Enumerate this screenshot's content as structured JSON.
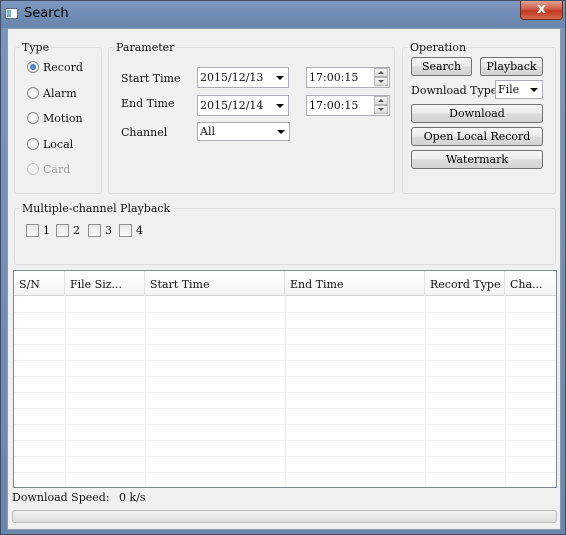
{
  "window": {
    "title": "Search",
    "close_glyph": "x"
  },
  "type_group": {
    "label": "Type",
    "options": [
      {
        "label": "Record",
        "checked": true,
        "enabled": true
      },
      {
        "label": "Alarm",
        "checked": false,
        "enabled": true
      },
      {
        "label": "Motion",
        "checked": false,
        "enabled": true
      },
      {
        "label": "Local",
        "checked": false,
        "enabled": true
      },
      {
        "label": "Card",
        "checked": false,
        "enabled": false
      }
    ]
  },
  "parameter_group": {
    "label": "Parameter",
    "start_time_label": "Start Time",
    "start_date": "2015/12/13",
    "start_time": "17:00:15",
    "end_time_label": "End Time",
    "end_date": "2015/12/14",
    "end_time": "17:00:15",
    "channel_label": "Channel",
    "channel_value": "All"
  },
  "operation_group": {
    "label": "Operation",
    "search_label": "Search",
    "playback_label": "Playback",
    "download_type_label": "Download Type",
    "download_type_value": "File",
    "download_label": "Download",
    "open_local_record_label": "Open Local Record",
    "watermark_label": "Watermark"
  },
  "multi_playback": {
    "label": "Multiple-channel Playback",
    "channels": [
      "1",
      "2",
      "3",
      "4"
    ]
  },
  "table": {
    "columns": [
      "S/N",
      "File Siz...",
      "Start Time",
      "End Time",
      "Record Type",
      "Cha..."
    ],
    "rows": []
  },
  "status": {
    "download_speed_label": "Download Speed:",
    "download_speed_value": "0 k/s",
    "progress_fraction": 0
  },
  "colors": {
    "titlebar": "#7191b8",
    "close_button": "#c7432a",
    "progress_fill": "#2fbf3a"
  }
}
